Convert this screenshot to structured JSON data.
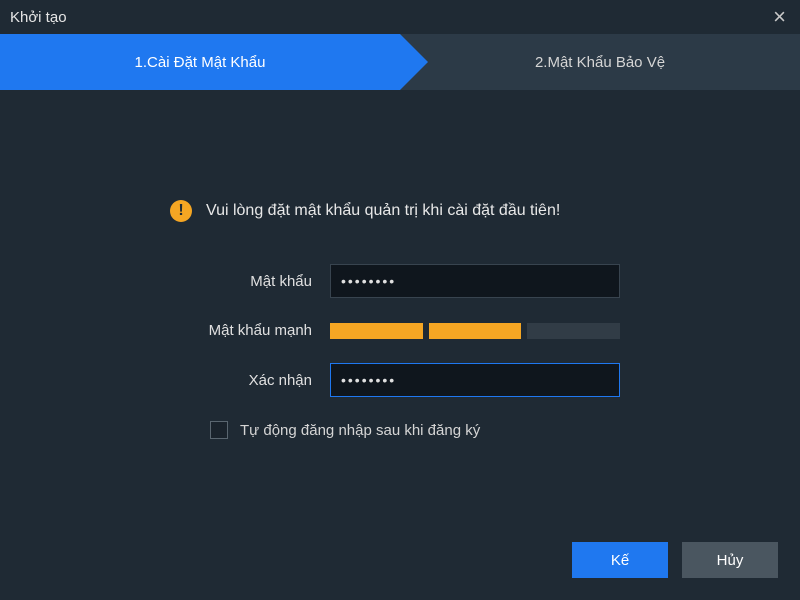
{
  "window": {
    "title": "Khởi tạo"
  },
  "steps": {
    "step1": "1.Cài Đặt Mật Khẩu",
    "step2": "2.Mật Khẩu Bảo Vệ"
  },
  "prompt": {
    "icon_glyph": "!",
    "text": "Vui lòng đặt mật khẩu quản trị khi cài đặt đầu tiên!"
  },
  "form": {
    "password_label": "Mật khẩu",
    "password_value": "••••••••",
    "strength_label": "Mật khẩu mạnh",
    "strength_segments_filled": 2,
    "strength_segments_total": 3,
    "confirm_label": "Xác nhận",
    "confirm_value": "••••••••",
    "autologin_label": "Tự động đăng nhập sau khi đăng ký",
    "autologin_checked": false
  },
  "buttons": {
    "next": "Kế",
    "cancel": "Hủy"
  }
}
